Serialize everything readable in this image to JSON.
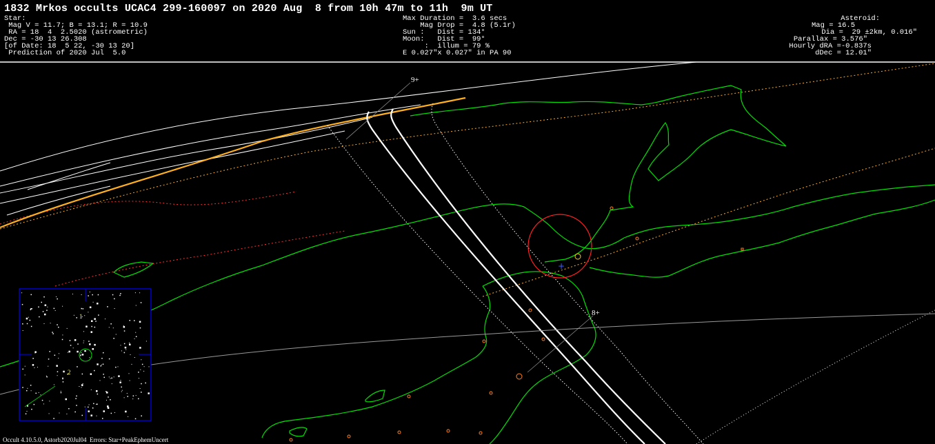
{
  "title": "1832 Mrkos occults UCAC4 299-160097 on 2020 Aug  8 from 10h 47m to 11h  9m UT",
  "star": {
    "lines": [
      "Star:",
      " Mag V = 11.7; B = 13.1; R = 10.9",
      " RA = 18  4  2.5020 (astrometric)",
      "Dec = -30 13 26.308",
      "[of Date: 18  5 22, -30 13 20]",
      " Prediction of 2020 Jul  5.0"
    ]
  },
  "event": {
    "lines": [
      "Max Duration =  3.6 secs",
      "    Mag Drop =  4.8 (5.1r)",
      "Sun :   Dist = 134°",
      "Moon:   Dist =  99°",
      "     :  illum = 79 %",
      "E 0.027\"x 0.027\" in PA 90"
    ]
  },
  "asteroid": {
    "lines": [
      "Asteroid:",
      "Mag = 16.5",
      "Dia =  29 ±2km, 0.016\"",
      "Parallax = 3.576\"",
      "Hourly dRA =-0.837s",
      "dDec = 12.01\""
    ]
  },
  "map": {
    "time_labels": [
      "9+",
      "8+"
    ],
    "finder_labels": [
      "1",
      "2"
    ],
    "colors": {
      "coastline": "#00e000",
      "centerline": "#ffffff",
      "sun_path": "#ffb020",
      "uncertainty": "#ff3030",
      "frame": "#0000ff"
    }
  },
  "footer": "Occult 4.10.5.0, Astorb2020Jul04  Errors: Star+PeakEphemUncert"
}
